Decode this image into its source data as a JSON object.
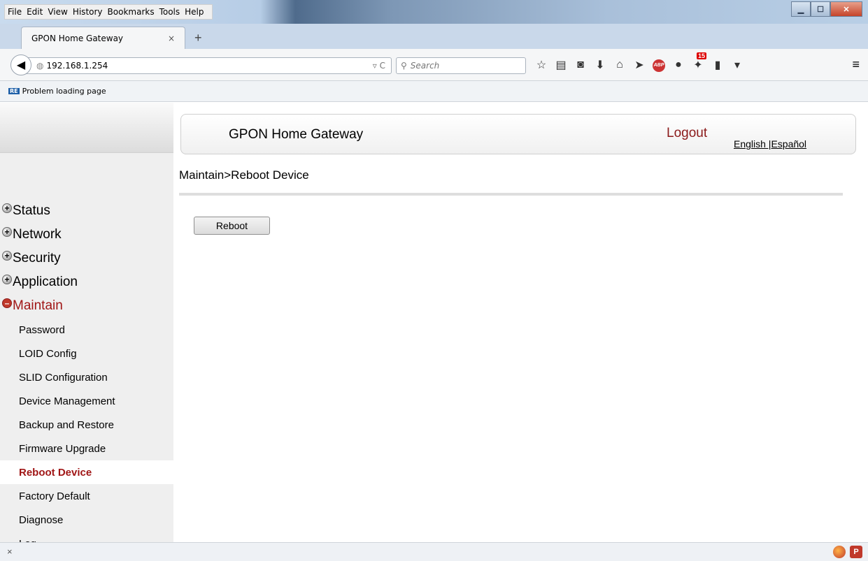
{
  "browser": {
    "menu": [
      "File",
      "Edit",
      "View",
      "History",
      "Bookmarks",
      "Tools",
      "Help"
    ],
    "tab_title": "GPON Home Gateway",
    "tab_close": "×",
    "new_tab": "+",
    "url": "192.168.1.254",
    "search_placeholder": "Search",
    "bookmark_label": "Problem loading page",
    "badge_count": "15",
    "abp_label": "ABP"
  },
  "header": {
    "app_name": "GPON Home Gateway",
    "logout": "Logout",
    "lang": "English |Español"
  },
  "breadcrumb": "Maintain>Reboot Device",
  "actions": {
    "reboot_label": "Reboot"
  },
  "sidebar": {
    "groups": [
      "Status",
      "Network",
      "Security",
      "Application",
      "Maintain"
    ],
    "maintain_items": [
      "Password",
      "LOID Config",
      "SLID Configuration",
      "Device Management",
      "Backup and Restore",
      "Firmware Upgrade",
      "Reboot Device",
      "Factory Default",
      "Diagnose",
      "Log"
    ]
  },
  "colors": {
    "accent": "#a01616"
  },
  "statusbar": {
    "close_glyph": "×",
    "p_label": "P"
  }
}
